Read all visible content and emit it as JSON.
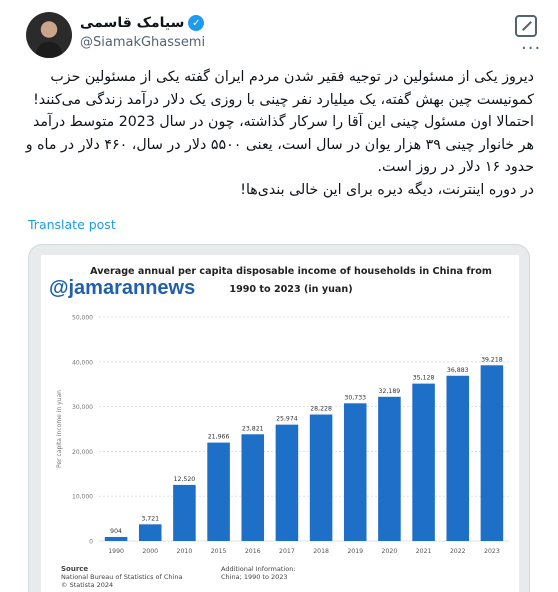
{
  "author": {
    "name": "سیامک قاسمی",
    "handle": "@SiamakGhassemi"
  },
  "icons": {
    "verified": "verified-badge-icon",
    "grok": "grok-icon",
    "more": "more-options-icon"
  },
  "tweet": {
    "lines": [
      "دیروز یکی از مسئولین در توجیه فقیر شدن مردم ایران گفته یکی از مسئولین حزب کمونیست چین بهش گفته، یک میلیارد نفر چینی با روزی یک دلار درآمد زندگی می‌کنند!",
      "احتمالا اون مسئول چینی این آقا را سرکار گذاشته، چون در سال 2023 متوسط درآمد هر خانوار چینی ۳۹ هزار یوان در سال است، یعنی ۵۵۰۰ دلار در سال، ۴۶۰ دلار در ماه و حدود ۱۶ دلار در روز است.",
      "در دوره اینترنت، دیگه دیره برای این خالی بندی‌ها!"
    ],
    "translate_label": "Translate post"
  },
  "media": {
    "watermark": "@jamarannews",
    "source_label": "Source",
    "source_text": "National Bureau of Statistics of China",
    "source_site": "© Statista 2024",
    "additional_label": "Additional Information:",
    "additional_text": "China; 1990 to 2023"
  },
  "colors": {
    "accent": "#1d9bf0",
    "bar": "#1e6fc7"
  },
  "chart_data": {
    "type": "bar",
    "title": "Average annual per capita disposable income of households in China from 1990 to 2023 (in yuan)",
    "ylabel": "Per capita income in yuan",
    "xlabel": "",
    "ylim": [
      0,
      50000
    ],
    "yticks": [
      "0",
      "10,000",
      "20,000",
      "30,000",
      "40,000",
      "50,000"
    ],
    "grid": true,
    "categories": [
      "1990",
      "2000",
      "2010",
      "2015",
      "2016",
      "2017",
      "2018",
      "2019",
      "2020",
      "2021",
      "2022",
      "2023"
    ],
    "values": [
      904,
      3721,
      12520,
      21966,
      23821,
      25974,
      28228,
      30733,
      32189,
      35128,
      36883,
      39218
    ],
    "labels": [
      "904",
      "3,721",
      "12,520",
      "21,966",
      "23,821",
      "25,974",
      "28,228",
      "30,733",
      "32,189",
      "35,128",
      "36,883",
      "39,218"
    ]
  }
}
